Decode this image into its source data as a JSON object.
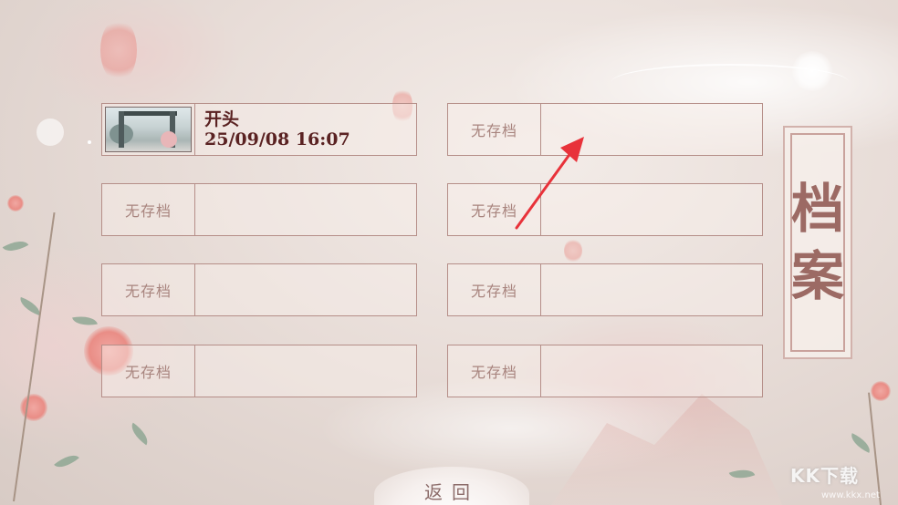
{
  "banner": {
    "char1": "档",
    "char2": "案"
  },
  "slots": [
    {
      "empty_label": "",
      "title": "开头",
      "time": "25/09/08 16:07"
    },
    {
      "empty_label": "无存档"
    },
    {
      "empty_label": "无存档"
    },
    {
      "empty_label": "无存档"
    },
    {
      "empty_label": "无存档"
    },
    {
      "empty_label": "无存档"
    },
    {
      "empty_label": "无存档"
    },
    {
      "empty_label": "无存档"
    }
  ],
  "back_label": "返回",
  "watermark": {
    "logo": "KK下载",
    "url": "www.kkx.net"
  },
  "colors": {
    "accent": "#5a2222",
    "border": "#b58e88",
    "annotation": "#e8323a"
  }
}
